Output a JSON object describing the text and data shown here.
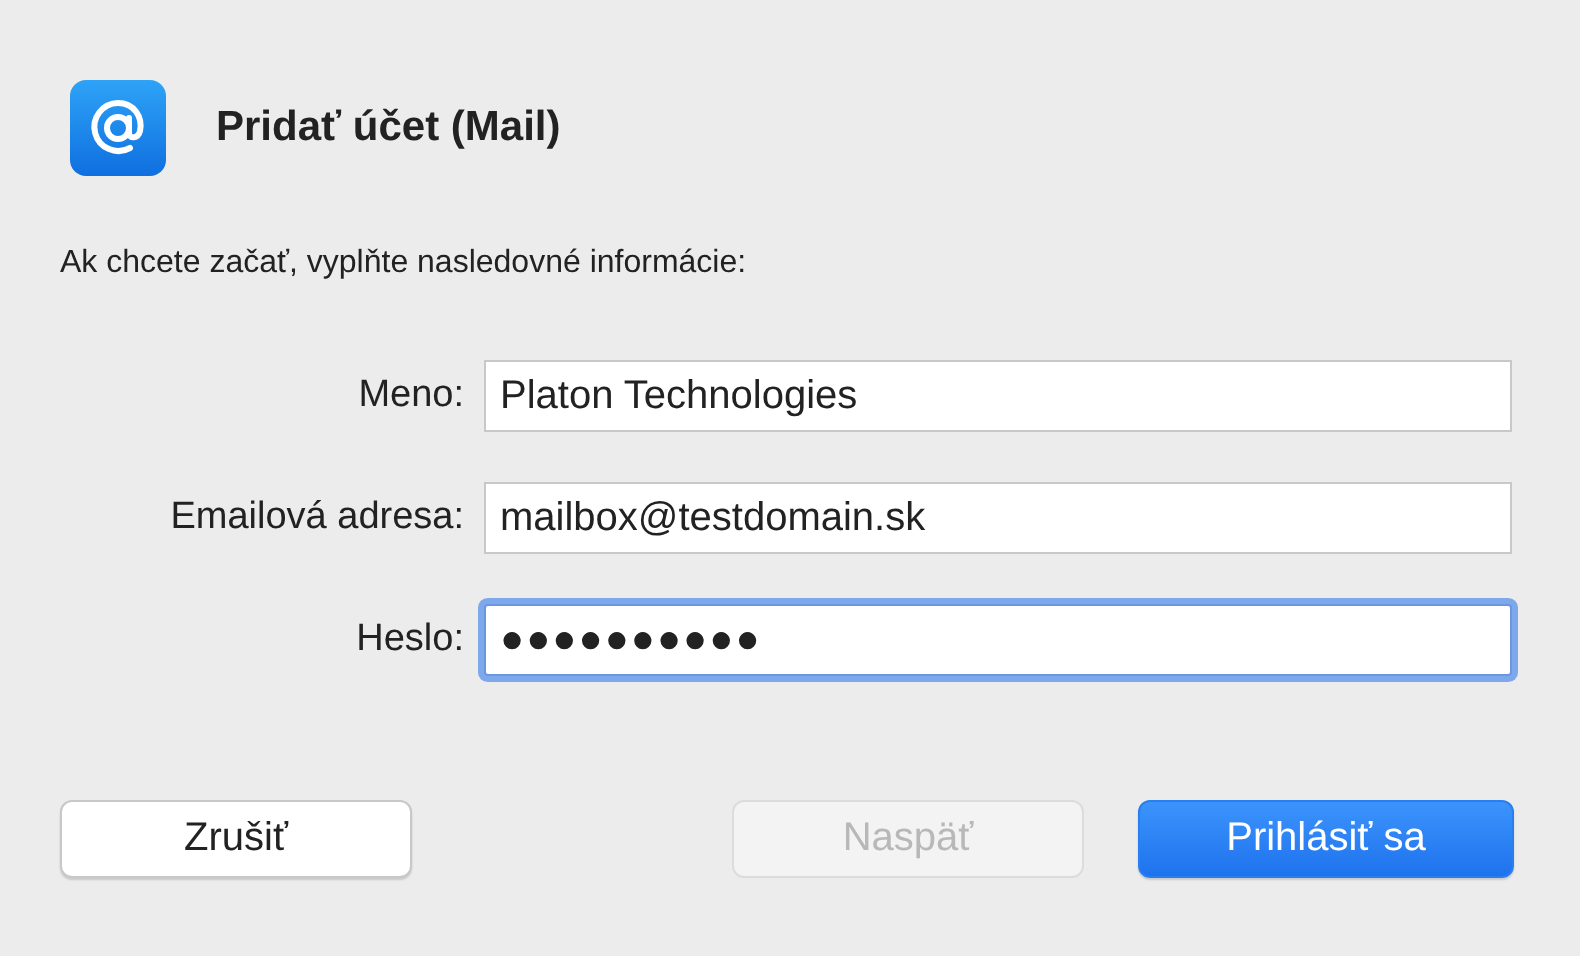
{
  "dialog": {
    "title": "Pridať účet (Mail)",
    "prompt": "Ak chcete začať, vyplňte nasledovné informácie:"
  },
  "fields": [
    {
      "label": "Meno:",
      "value": "Platon Technologies",
      "focused": false
    },
    {
      "label": "Emailová adresa:",
      "value": "mailbox@testdomain.sk",
      "focused": false
    },
    {
      "label": "Heslo:",
      "value": "●●●●●●●●●●",
      "focused": true
    }
  ],
  "buttons": [
    {
      "label": "Zrušiť",
      "kind": "secondary",
      "disabled": false
    },
    {
      "label": "Naspäť",
      "kind": "secondary",
      "disabled": true
    },
    {
      "label": "Prihlásiť sa",
      "kind": "primary",
      "disabled": false
    }
  ]
}
